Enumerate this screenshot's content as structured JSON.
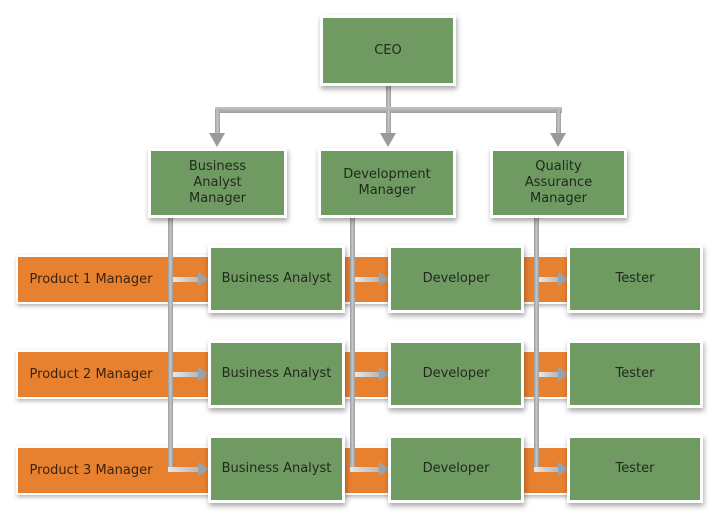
{
  "diagram": {
    "type": "org-chart",
    "top": {
      "label": "CEO"
    },
    "functional_managers": [
      {
        "label": "Business Analyst Manager"
      },
      {
        "label": "Development Manager"
      },
      {
        "label": "Quality Assurance Manager"
      }
    ],
    "product_rows": [
      {
        "manager": "Product 1 Manager",
        "roles": [
          "Business Analyst",
          "Developer",
          "Tester"
        ]
      },
      {
        "manager": "Product 2 Manager",
        "roles": [
          "Business Analyst",
          "Developer",
          "Tester"
        ]
      },
      {
        "manager": "Product 3 Manager",
        "roles": [
          "Business Analyst",
          "Developer",
          "Tester"
        ]
      }
    ],
    "colors": {
      "box_fill": "#6f9a62",
      "band_fill": "#e8812f",
      "connector": "#a8a8a8"
    }
  }
}
